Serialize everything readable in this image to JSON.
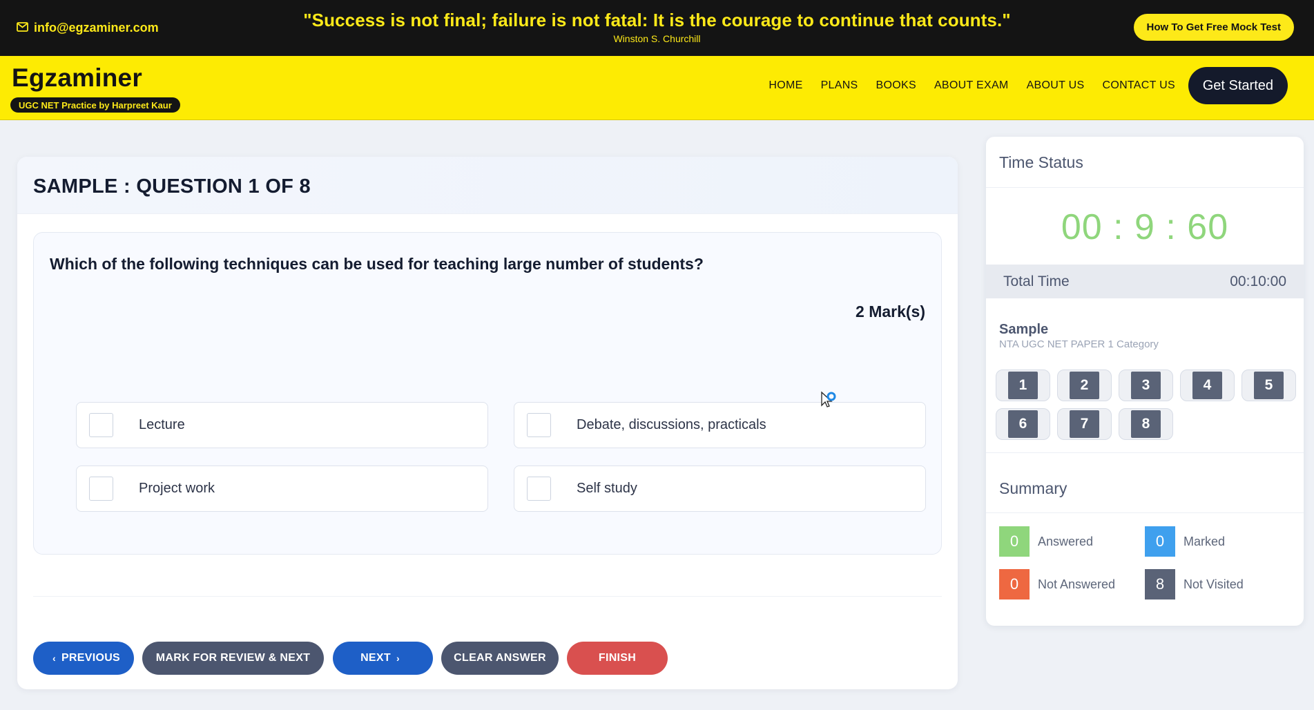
{
  "topbar": {
    "email": "info@egzaminer.com",
    "quote": "\"Success is not final; failure is not fatal: It is the courage to continue that counts.\"",
    "author": "Winston S. Churchill",
    "mock_button": "How To Get Free Mock Test"
  },
  "nav": {
    "logo": "Egzaminer",
    "tagline": "UGC NET Practice by Harpreet Kaur",
    "menu": [
      "HOME",
      "PLANS",
      "BOOKS",
      "ABOUT EXAM",
      "ABOUT US",
      "CONTACT US"
    ],
    "cta": "Get Started"
  },
  "question": {
    "title": "SAMPLE : QUESTION 1 OF 8",
    "text": "Which of the following techniques can be used for teaching large number of students?",
    "marks": "2 Mark(s)",
    "options": [
      "Lecture",
      "Debate, discussions, practicals",
      "Project work",
      "Self study"
    ]
  },
  "actions": {
    "previous": "PREVIOUS",
    "mark_review": "MARK FOR REVIEW & NEXT",
    "next": "NEXT",
    "clear": "CLEAR ANSWER",
    "finish": "FINISH"
  },
  "time_status": {
    "title": "Time Status",
    "countdown": "00 : 9 : 60",
    "total_label": "Total Time",
    "total_value": "00:10:00"
  },
  "palette": {
    "section": "Sample",
    "category": "NTA UGC NET PAPER 1 Category",
    "numbers": [
      "1",
      "2",
      "3",
      "4",
      "5",
      "6",
      "7",
      "8"
    ]
  },
  "summary": {
    "title": "Summary",
    "answered_count": "0",
    "answered_label": "Answered",
    "marked_count": "0",
    "marked_label": "Marked",
    "not_answered_count": "0",
    "not_answered_label": "Not Answered",
    "not_visited_count": "8",
    "not_visited_label": "Not Visited"
  },
  "colors": {
    "brand_yellow": "#fdeb03",
    "primary_blue": "#1e5fc7",
    "answered_green": "#8fd67c",
    "marked_blue": "#3fa0ee",
    "not_answered_orange": "#ee6841",
    "not_visited_gray": "#5a6377",
    "finish_red": "#d9504f"
  }
}
